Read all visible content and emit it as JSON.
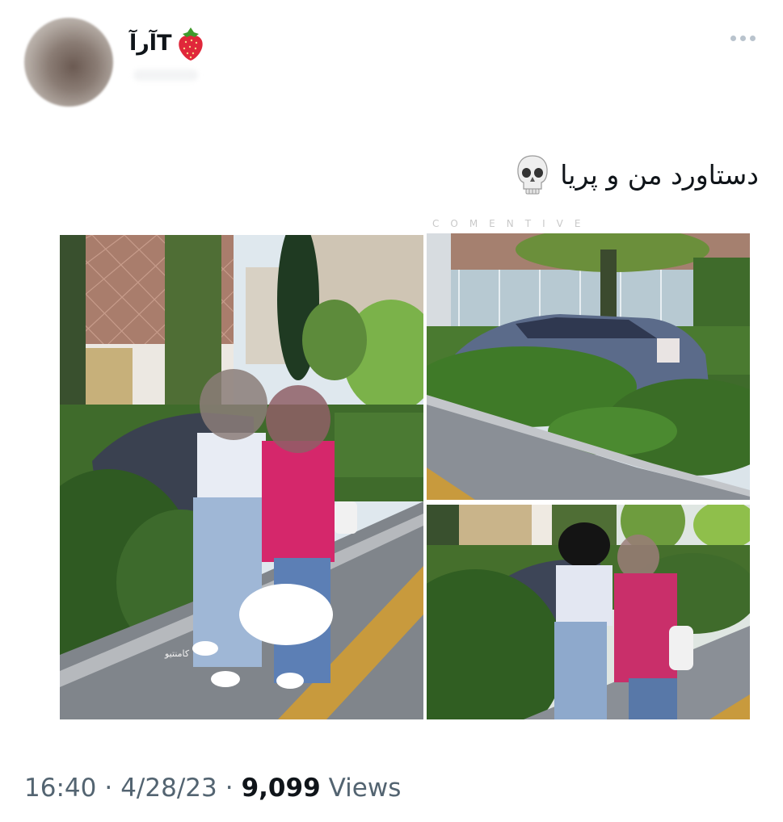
{
  "author": {
    "display_name": "آرآT"
  },
  "tweet": {
    "text": "دستاورد من و پریا"
  },
  "media": {
    "watermark": "COMENTIVE",
    "photo_watermark": "کامنتیو"
  },
  "meta": {
    "time": "16:40",
    "date": "4/28/23",
    "separator": "·",
    "views_count": "9,099",
    "views_label": "Views"
  },
  "colors": {
    "text_primary": "#0f1419",
    "text_secondary": "#536471",
    "more_dots": "#b9c3cd"
  },
  "icons": [
    "strawberry-icon",
    "skull-icon",
    "more-icon"
  ]
}
